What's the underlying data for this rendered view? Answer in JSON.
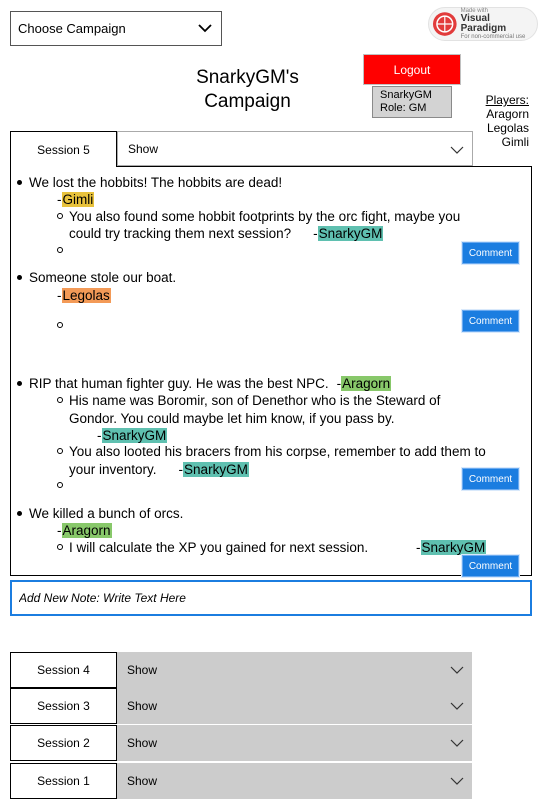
{
  "campaign_select": {
    "label": "Choose Campaign"
  },
  "badge": {
    "small": "Made with",
    "brand": "Visual Paradigm",
    "note": "For non-commercial use"
  },
  "header": {
    "title_line1": "SnarkyGM's",
    "title_line2": "Campaign",
    "logout_label": "Logout"
  },
  "user": {
    "name": "SnarkyGM",
    "role": "Role: GM"
  },
  "players": {
    "label": "Players:",
    "list": [
      "Aragorn",
      "Legolas",
      "Gimli"
    ]
  },
  "current_session": {
    "tab_label": "Session 5",
    "show_label": "Show"
  },
  "notes": [
    {
      "text": "We lost the hobbits! The hobbits are dead!",
      "author": "Gimli",
      "comments": [
        {
          "text": "You also found some hobbit footprints by the orc fight, maybe you",
          "text2": "could try tracking them next session?",
          "author": "SnarkyGM"
        }
      ]
    },
    {
      "text": "Someone stole our boat.",
      "author": "Legolas",
      "comments": []
    },
    {
      "text": "RIP that human fighter guy. He was the best NPC.",
      "author": "Aragorn",
      "comments": [
        {
          "text": "His name was Boromir, son of Denethor who is the Steward of",
          "text2": "Gondor. You could maybe let him know, if you pass by.",
          "author": "SnarkyGM"
        },
        {
          "text": "You also looted his bracers from his corpse, remember to add them to",
          "text2": "your inventory.",
          "author": "SnarkyGM"
        }
      ]
    },
    {
      "text": "We killed a bunch of orcs.",
      "author": "Aragorn",
      "comments": [
        {
          "text": "I will calculate the XP you gained for next session.",
          "author": "SnarkyGM"
        }
      ]
    }
  ],
  "author_prefix": "-",
  "comment_label": "Comment",
  "new_note": {
    "placeholder": "Add New Note: Write Text Here"
  },
  "sessions": [
    {
      "label": "Session 4",
      "show": "Show"
    },
    {
      "label": "Session 3",
      "show": "Show"
    },
    {
      "label": "Session 2",
      "show": "Show"
    },
    {
      "label": "Session 1",
      "show": "Show"
    }
  ],
  "colors": {
    "gimli": "#e8c23c",
    "legolas": "#f39a57",
    "aragorn": "#88c86a",
    "gm": "#5fc0b0",
    "comment_button": "#1b7de0",
    "logout": "#ff0000"
  }
}
